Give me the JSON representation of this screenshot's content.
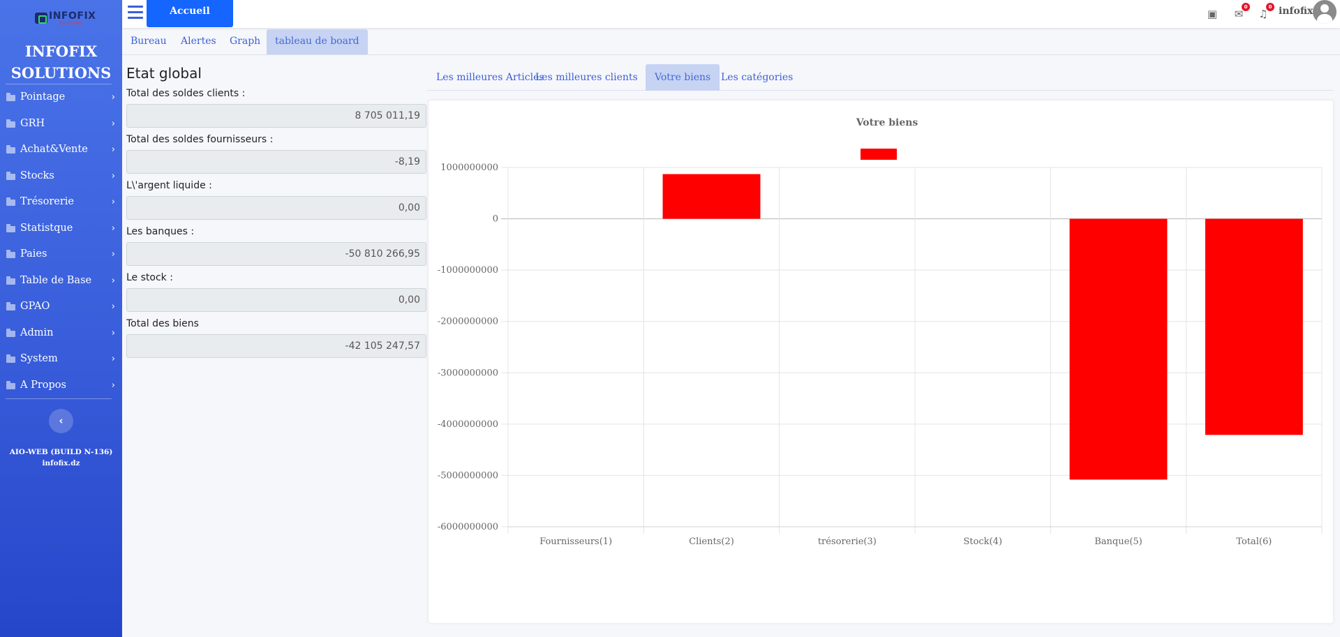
{
  "sidebar": {
    "logo_text": "INFOFIX",
    "logo_sub": "SOLUTIONS",
    "brand_line1": "INFOFIX",
    "brand_line2": "SOLUTIONS",
    "items": [
      {
        "label": "Pointage"
      },
      {
        "label": "GRH"
      },
      {
        "label": "Achat&Vente"
      },
      {
        "label": "Stocks"
      },
      {
        "label": "Trésorerie"
      },
      {
        "label": "Statistque"
      },
      {
        "label": "Paies"
      },
      {
        "label": "Table de Base"
      },
      {
        "label": "GPAO"
      },
      {
        "label": "Admin"
      },
      {
        "label": "System"
      },
      {
        "label": "A Propos"
      }
    ],
    "build_line1": "AIO-WEB (BUILD N-136)",
    "build_line2": "infofix.dz"
  },
  "header": {
    "home_label": "Accueil",
    "user_name": "infofix",
    "mail_badge": "0",
    "notif_badge": "0"
  },
  "tabs": [
    {
      "label": "Bureau",
      "active": false
    },
    {
      "label": "Alertes",
      "active": false
    },
    {
      "label": "Graph",
      "active": false
    },
    {
      "label": "tableau de board",
      "active": true
    }
  ],
  "etat": {
    "title": "Etat global",
    "fields": [
      {
        "label": "Total des soldes clients :",
        "value": "8 705 011,19"
      },
      {
        "label": "Total des soldes fournisseurs :",
        "value": "-8,19"
      },
      {
        "label": "L\\'argent liquide :",
        "value": "0,00"
      },
      {
        "label": "Les banques :",
        "value": "-50 810 266,95"
      },
      {
        "label": "Le stock :",
        "value": "0,00"
      },
      {
        "label": "Total des biens",
        "value": "-42 105 247,57"
      }
    ]
  },
  "chart_tabs": [
    {
      "label": "Les milleures Articles",
      "active": false
    },
    {
      "label": "Les milleures clients",
      "active": false
    },
    {
      "label": "Votre biens",
      "active": true
    },
    {
      "label": "Les catégories",
      "active": false
    }
  ],
  "colors": {
    "bar": "#ff0000",
    "accent": "#1565ff",
    "sidebar": "#3a5fdc"
  },
  "chart_data": {
    "type": "bar",
    "title": "Votre biens",
    "categories": [
      "Fournisseurs(1)",
      "Clients(2)",
      "trésorerie(3)",
      "Stock(4)",
      "Banque(5)",
      "Total(6)"
    ],
    "series": [
      {
        "values": [
          -819,
          870501119,
          0,
          0,
          -5081026695,
          -4210524757
        ]
      }
    ],
    "yticks": [
      "1000000000",
      "0",
      "-1000000000",
      "-2000000000",
      "-3000000000",
      "-4000000000",
      "-5000000000",
      "-6000000000"
    ],
    "ylim": [
      -6000000000,
      1000000000
    ],
    "grid": true,
    "legend": "top"
  }
}
